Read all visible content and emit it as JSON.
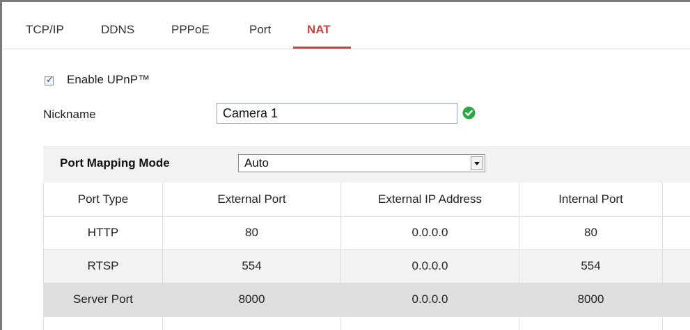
{
  "tabs": [
    {
      "label": "TCP/IP",
      "active": false
    },
    {
      "label": "DDNS",
      "active": false
    },
    {
      "label": "PPPoE",
      "active": false
    },
    {
      "label": "Port",
      "active": false
    },
    {
      "label": "NAT",
      "active": true
    }
  ],
  "upnp": {
    "label": "Enable UPnP™",
    "checked": true
  },
  "nickname": {
    "label": "Nickname",
    "value": "Camera 1",
    "status_icon": "check-circle-icon"
  },
  "mapping": {
    "label": "Port Mapping Mode",
    "selected": "Auto"
  },
  "table": {
    "headers": [
      "Port Type",
      "External Port",
      "External IP Address",
      "Internal Port"
    ],
    "rows": [
      [
        "HTTP",
        "80",
        "0.0.0.0",
        "80"
      ],
      [
        "RTSP",
        "554",
        "0.0.0.0",
        "554"
      ],
      [
        "Server Port",
        "8000",
        "0.0.0.0",
        "8000"
      ]
    ]
  },
  "colors": {
    "accent": "#d43b3b",
    "ok": "#2aa843",
    "row_alt": "#f2f2f2",
    "row_selected": "#dedede"
  }
}
